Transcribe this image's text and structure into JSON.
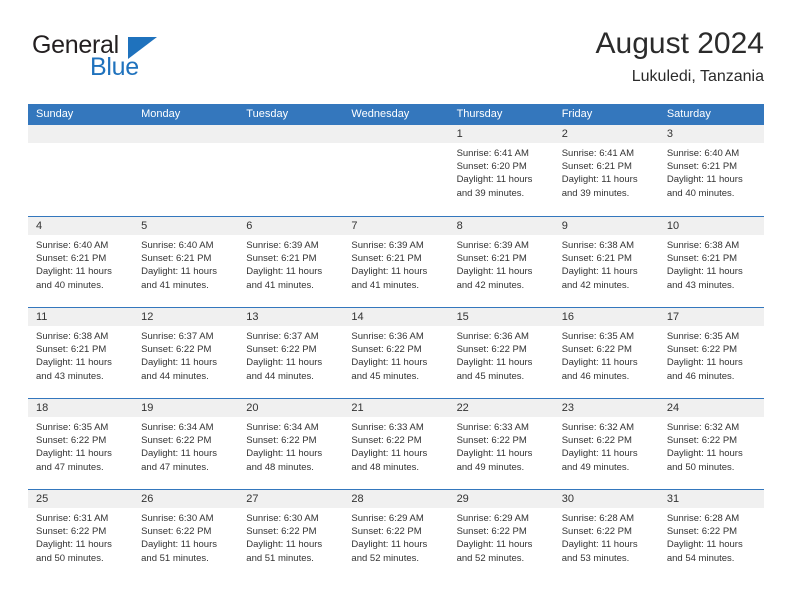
{
  "branding": {
    "logo_word_1": "General",
    "logo_word_2": "Blue",
    "accent_color": "#1f72bd"
  },
  "header": {
    "title": "August 2024",
    "subtitle": "Lukuledi, Tanzania"
  },
  "calendar": {
    "header_bg_color": "#3477bd",
    "day_band_color": "#f0f0f0",
    "weekdays": [
      "Sunday",
      "Monday",
      "Tuesday",
      "Wednesday",
      "Thursday",
      "Friday",
      "Saturday"
    ],
    "weeks": [
      [
        {
          "day": "",
          "sunrise": "",
          "sunset": "",
          "daylight_line1": "",
          "daylight_line2": ""
        },
        {
          "day": "",
          "sunrise": "",
          "sunset": "",
          "daylight_line1": "",
          "daylight_line2": ""
        },
        {
          "day": "",
          "sunrise": "",
          "sunset": "",
          "daylight_line1": "",
          "daylight_line2": ""
        },
        {
          "day": "",
          "sunrise": "",
          "sunset": "",
          "daylight_line1": "",
          "daylight_line2": ""
        },
        {
          "day": "1",
          "sunrise": "Sunrise: 6:41 AM",
          "sunset": "Sunset: 6:20 PM",
          "daylight_line1": "Daylight: 11 hours",
          "daylight_line2": "and 39 minutes."
        },
        {
          "day": "2",
          "sunrise": "Sunrise: 6:41 AM",
          "sunset": "Sunset: 6:21 PM",
          "daylight_line1": "Daylight: 11 hours",
          "daylight_line2": "and 39 minutes."
        },
        {
          "day": "3",
          "sunrise": "Sunrise: 6:40 AM",
          "sunset": "Sunset: 6:21 PM",
          "daylight_line1": "Daylight: 11 hours",
          "daylight_line2": "and 40 minutes."
        }
      ],
      [
        {
          "day": "4",
          "sunrise": "Sunrise: 6:40 AM",
          "sunset": "Sunset: 6:21 PM",
          "daylight_line1": "Daylight: 11 hours",
          "daylight_line2": "and 40 minutes."
        },
        {
          "day": "5",
          "sunrise": "Sunrise: 6:40 AM",
          "sunset": "Sunset: 6:21 PM",
          "daylight_line1": "Daylight: 11 hours",
          "daylight_line2": "and 41 minutes."
        },
        {
          "day": "6",
          "sunrise": "Sunrise: 6:39 AM",
          "sunset": "Sunset: 6:21 PM",
          "daylight_line1": "Daylight: 11 hours",
          "daylight_line2": "and 41 minutes."
        },
        {
          "day": "7",
          "sunrise": "Sunrise: 6:39 AM",
          "sunset": "Sunset: 6:21 PM",
          "daylight_line1": "Daylight: 11 hours",
          "daylight_line2": "and 41 minutes."
        },
        {
          "day": "8",
          "sunrise": "Sunrise: 6:39 AM",
          "sunset": "Sunset: 6:21 PM",
          "daylight_line1": "Daylight: 11 hours",
          "daylight_line2": "and 42 minutes."
        },
        {
          "day": "9",
          "sunrise": "Sunrise: 6:38 AM",
          "sunset": "Sunset: 6:21 PM",
          "daylight_line1": "Daylight: 11 hours",
          "daylight_line2": "and 42 minutes."
        },
        {
          "day": "10",
          "sunrise": "Sunrise: 6:38 AM",
          "sunset": "Sunset: 6:21 PM",
          "daylight_line1": "Daylight: 11 hours",
          "daylight_line2": "and 43 minutes."
        }
      ],
      [
        {
          "day": "11",
          "sunrise": "Sunrise: 6:38 AM",
          "sunset": "Sunset: 6:21 PM",
          "daylight_line1": "Daylight: 11 hours",
          "daylight_line2": "and 43 minutes."
        },
        {
          "day": "12",
          "sunrise": "Sunrise: 6:37 AM",
          "sunset": "Sunset: 6:22 PM",
          "daylight_line1": "Daylight: 11 hours",
          "daylight_line2": "and 44 minutes."
        },
        {
          "day": "13",
          "sunrise": "Sunrise: 6:37 AM",
          "sunset": "Sunset: 6:22 PM",
          "daylight_line1": "Daylight: 11 hours",
          "daylight_line2": "and 44 minutes."
        },
        {
          "day": "14",
          "sunrise": "Sunrise: 6:36 AM",
          "sunset": "Sunset: 6:22 PM",
          "daylight_line1": "Daylight: 11 hours",
          "daylight_line2": "and 45 minutes."
        },
        {
          "day": "15",
          "sunrise": "Sunrise: 6:36 AM",
          "sunset": "Sunset: 6:22 PM",
          "daylight_line1": "Daylight: 11 hours",
          "daylight_line2": "and 45 minutes."
        },
        {
          "day": "16",
          "sunrise": "Sunrise: 6:35 AM",
          "sunset": "Sunset: 6:22 PM",
          "daylight_line1": "Daylight: 11 hours",
          "daylight_line2": "and 46 minutes."
        },
        {
          "day": "17",
          "sunrise": "Sunrise: 6:35 AM",
          "sunset": "Sunset: 6:22 PM",
          "daylight_line1": "Daylight: 11 hours",
          "daylight_line2": "and 46 minutes."
        }
      ],
      [
        {
          "day": "18",
          "sunrise": "Sunrise: 6:35 AM",
          "sunset": "Sunset: 6:22 PM",
          "daylight_line1": "Daylight: 11 hours",
          "daylight_line2": "and 47 minutes."
        },
        {
          "day": "19",
          "sunrise": "Sunrise: 6:34 AM",
          "sunset": "Sunset: 6:22 PM",
          "daylight_line1": "Daylight: 11 hours",
          "daylight_line2": "and 47 minutes."
        },
        {
          "day": "20",
          "sunrise": "Sunrise: 6:34 AM",
          "sunset": "Sunset: 6:22 PM",
          "daylight_line1": "Daylight: 11 hours",
          "daylight_line2": "and 48 minutes."
        },
        {
          "day": "21",
          "sunrise": "Sunrise: 6:33 AM",
          "sunset": "Sunset: 6:22 PM",
          "daylight_line1": "Daylight: 11 hours",
          "daylight_line2": "and 48 minutes."
        },
        {
          "day": "22",
          "sunrise": "Sunrise: 6:33 AM",
          "sunset": "Sunset: 6:22 PM",
          "daylight_line1": "Daylight: 11 hours",
          "daylight_line2": "and 49 minutes."
        },
        {
          "day": "23",
          "sunrise": "Sunrise: 6:32 AM",
          "sunset": "Sunset: 6:22 PM",
          "daylight_line1": "Daylight: 11 hours",
          "daylight_line2": "and 49 minutes."
        },
        {
          "day": "24",
          "sunrise": "Sunrise: 6:32 AM",
          "sunset": "Sunset: 6:22 PM",
          "daylight_line1": "Daylight: 11 hours",
          "daylight_line2": "and 50 minutes."
        }
      ],
      [
        {
          "day": "25",
          "sunrise": "Sunrise: 6:31 AM",
          "sunset": "Sunset: 6:22 PM",
          "daylight_line1": "Daylight: 11 hours",
          "daylight_line2": "and 50 minutes."
        },
        {
          "day": "26",
          "sunrise": "Sunrise: 6:30 AM",
          "sunset": "Sunset: 6:22 PM",
          "daylight_line1": "Daylight: 11 hours",
          "daylight_line2": "and 51 minutes."
        },
        {
          "day": "27",
          "sunrise": "Sunrise: 6:30 AM",
          "sunset": "Sunset: 6:22 PM",
          "daylight_line1": "Daylight: 11 hours",
          "daylight_line2": "and 51 minutes."
        },
        {
          "day": "28",
          "sunrise": "Sunrise: 6:29 AM",
          "sunset": "Sunset: 6:22 PM",
          "daylight_line1": "Daylight: 11 hours",
          "daylight_line2": "and 52 minutes."
        },
        {
          "day": "29",
          "sunrise": "Sunrise: 6:29 AM",
          "sunset": "Sunset: 6:22 PM",
          "daylight_line1": "Daylight: 11 hours",
          "daylight_line2": "and 52 minutes."
        },
        {
          "day": "30",
          "sunrise": "Sunrise: 6:28 AM",
          "sunset": "Sunset: 6:22 PM",
          "daylight_line1": "Daylight: 11 hours",
          "daylight_line2": "and 53 minutes."
        },
        {
          "day": "31",
          "sunrise": "Sunrise: 6:28 AM",
          "sunset": "Sunset: 6:22 PM",
          "daylight_line1": "Daylight: 11 hours",
          "daylight_line2": "and 54 minutes."
        }
      ]
    ]
  }
}
